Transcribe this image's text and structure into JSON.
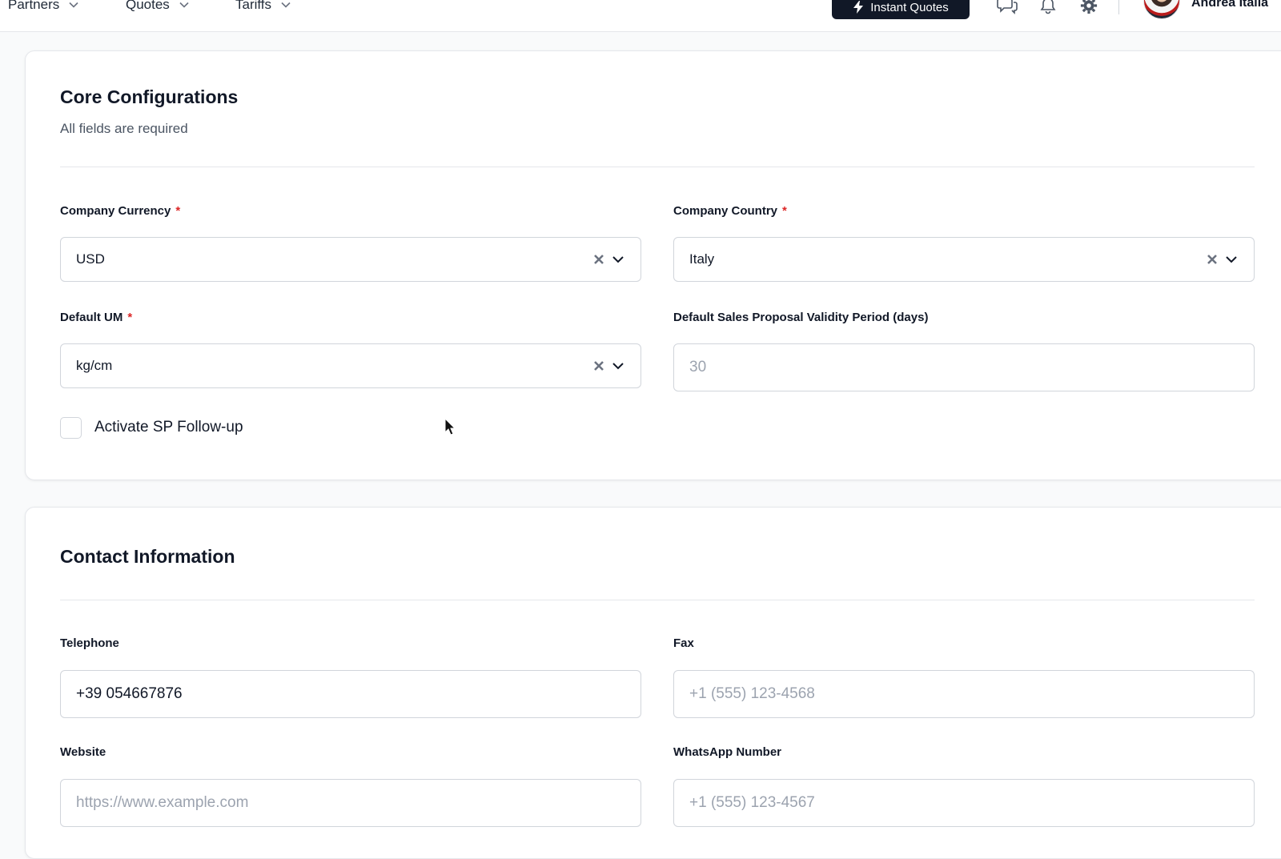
{
  "topnav": {
    "items": [
      {
        "label": "Partners"
      },
      {
        "label": "Quotes"
      },
      {
        "label": "Tariffs"
      }
    ],
    "instant_quotes_label": "Instant Quotes",
    "user_name": "Andrea Italia"
  },
  "core": {
    "title": "Core Configurations",
    "subtitle": "All fields are required",
    "currency": {
      "label": "Company Currency",
      "required_mark": "*",
      "value": "USD"
    },
    "country": {
      "label": "Company Country",
      "required_mark": "*",
      "value": "Italy"
    },
    "um": {
      "label": "Default UM",
      "required_mark": "*",
      "value": "kg/cm"
    },
    "validity": {
      "label": "Default Sales Proposal Validity Period (days)",
      "placeholder": "30"
    },
    "followup": {
      "label": "Activate SP Follow-up",
      "checked": false
    }
  },
  "contact": {
    "title": "Contact Information",
    "telephone": {
      "label": "Telephone",
      "value": "+39 054667876"
    },
    "fax": {
      "label": "Fax",
      "placeholder": "+1 (555) 123-4568"
    },
    "website": {
      "label": "Website",
      "placeholder": "https://www.example.com"
    },
    "whatsapp": {
      "label": "WhatsApp Number",
      "placeholder": "+1 (555) 123-4567"
    }
  },
  "icons": {
    "chat": "chat-icon",
    "bell": "bell-icon",
    "gear": "gear-icon",
    "bolt": "bolt-icon",
    "clear": "clear-icon",
    "chevron": "chevron-down-icon"
  }
}
